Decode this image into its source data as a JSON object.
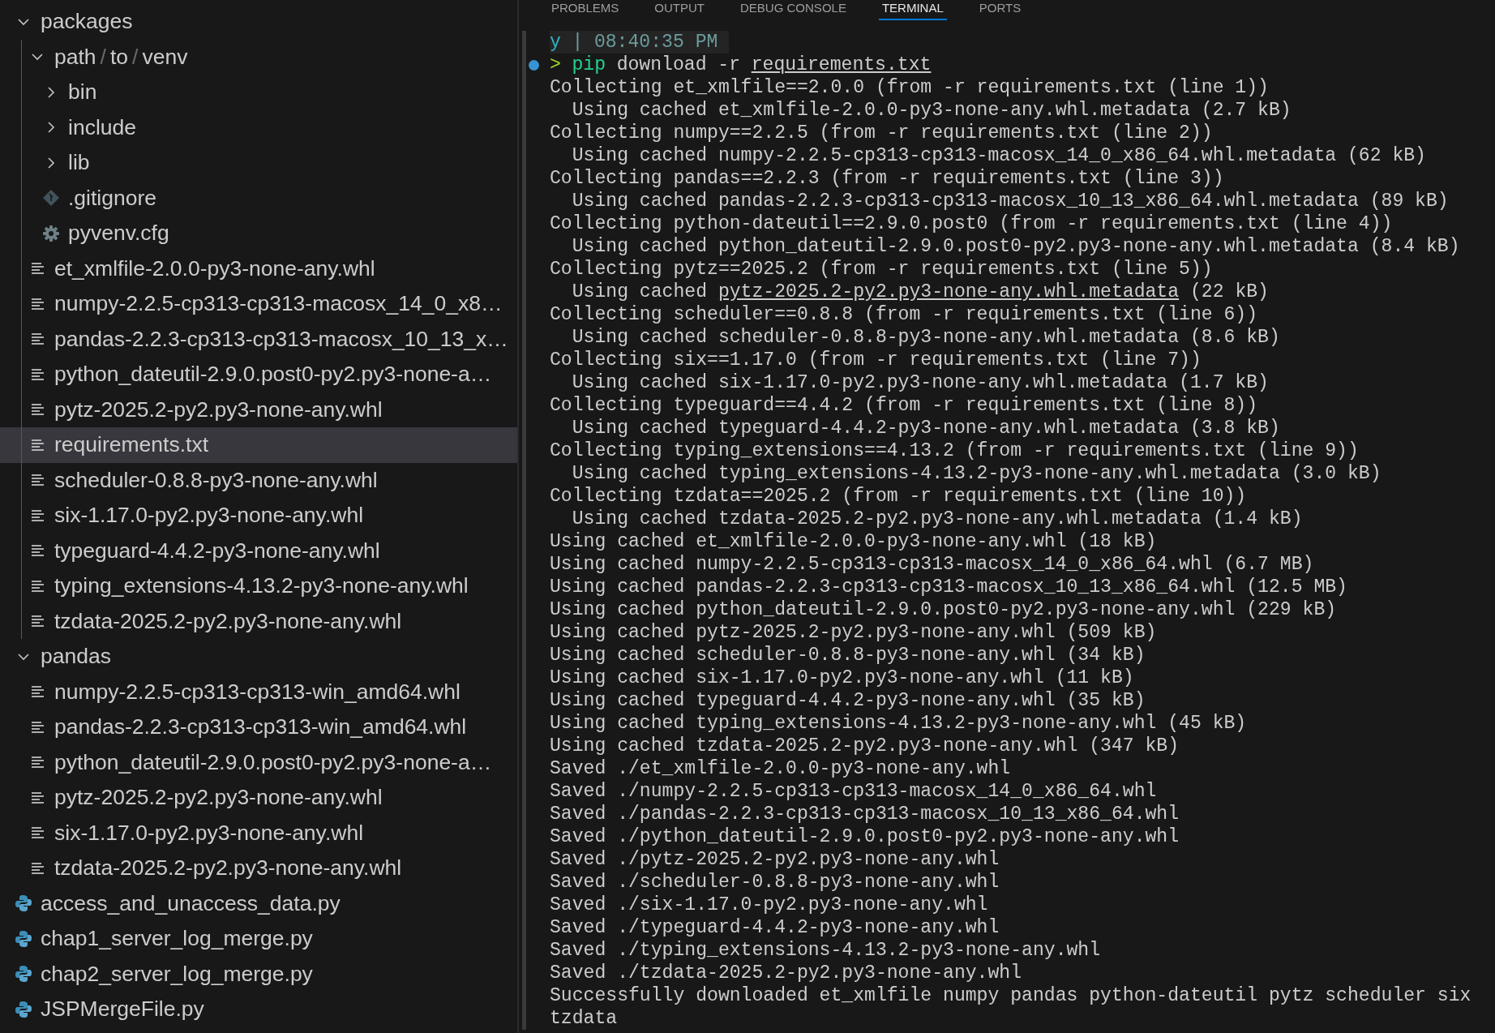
{
  "explorer": {
    "tree": [
      {
        "label": "packages",
        "kind": "folder",
        "expanded": true,
        "selected": false,
        "children": [
          {
            "label_parts": [
              {
                "text": "path",
                "kind": "name"
              },
              {
                "text": "/",
                "kind": "separator"
              },
              {
                "text": "to",
                "kind": "name"
              },
              {
                "text": "/",
                "kind": "separator"
              },
              {
                "text": "venv",
                "kind": "name"
              }
            ],
            "kind": "folder",
            "expanded": true,
            "selected": false,
            "children": [
              {
                "label": "bin",
                "kind": "folder",
                "expanded": false,
                "selected": false
              },
              {
                "label": "include",
                "kind": "folder",
                "expanded": false,
                "selected": false
              },
              {
                "label": "lib",
                "kind": "folder",
                "expanded": false,
                "selected": false
              },
              {
                "label": ".gitignore",
                "kind": "git-file",
                "selected": false
              },
              {
                "label": "pyvenv.cfg",
                "kind": "config-file",
                "selected": false
              }
            ]
          },
          {
            "label": "et_xmlfile-2.0.0-py3-none-any.whl",
            "kind": "text-file",
            "selected": false
          },
          {
            "label": "numpy-2.2.5-cp313-cp313-macosx_14_0_x8…",
            "kind": "text-file",
            "selected": false
          },
          {
            "label": "pandas-2.2.3-cp313-cp313-macosx_10_13_x…",
            "kind": "text-file",
            "selected": false
          },
          {
            "label": "python_dateutil-2.9.0.post0-py2.py3-none-a…",
            "kind": "text-file",
            "selected": false
          },
          {
            "label": "pytz-2025.2-py2.py3-none-any.whl",
            "kind": "text-file",
            "selected": false
          },
          {
            "label": "requirements.txt",
            "kind": "text-file",
            "selected": true
          },
          {
            "label": "scheduler-0.8.8-py3-none-any.whl",
            "kind": "text-file",
            "selected": false
          },
          {
            "label": "six-1.17.0-py2.py3-none-any.whl",
            "kind": "text-file",
            "selected": false
          },
          {
            "label": "typeguard-4.4.2-py3-none-any.whl",
            "kind": "text-file",
            "selected": false
          },
          {
            "label": "typing_extensions-4.13.2-py3-none-any.whl",
            "kind": "text-file",
            "selected": false
          },
          {
            "label": "tzdata-2025.2-py2.py3-none-any.whl",
            "kind": "text-file",
            "selected": false
          }
        ]
      },
      {
        "label": "pandas",
        "kind": "folder",
        "expanded": true,
        "selected": false,
        "children": [
          {
            "label": "numpy-2.2.5-cp313-cp313-win_amd64.whl",
            "kind": "text-file",
            "selected": false
          },
          {
            "label": "pandas-2.2.3-cp313-cp313-win_amd64.whl",
            "kind": "text-file",
            "selected": false
          },
          {
            "label": "python_dateutil-2.9.0.post0-py2.py3-none-a…",
            "kind": "text-file",
            "selected": false
          },
          {
            "label": "pytz-2025.2-py2.py3-none-any.whl",
            "kind": "text-file",
            "selected": false
          },
          {
            "label": "six-1.17.0-py2.py3-none-any.whl",
            "kind": "text-file",
            "selected": false
          },
          {
            "label": "tzdata-2025.2-py2.py3-none-any.whl",
            "kind": "text-file",
            "selected": false
          }
        ]
      },
      {
        "label": "access_and_unaccess_data.py",
        "kind": "python-file",
        "selected": false
      },
      {
        "label": "chap1_server_log_merge.py",
        "kind": "python-file",
        "selected": false
      },
      {
        "label": "chap2_server_log_merge.py",
        "kind": "python-file",
        "selected": false
      },
      {
        "label": "JSPMergeFile.py",
        "kind": "python-file",
        "selected": false
      }
    ]
  },
  "panel": {
    "tabs": [
      {
        "label": "PROBLEMS",
        "selected": false
      },
      {
        "label": "OUTPUT",
        "selected": false
      },
      {
        "label": "DEBUG CONSOLE",
        "selected": false
      },
      {
        "label": "TERMINAL",
        "selected": true
      },
      {
        "label": "PORTS",
        "selected": false
      }
    ],
    "terminal": {
      "lines": [
        {
          "kind": "header",
          "user": "y",
          "separator": "|",
          "time": "08:40:35 PM"
        },
        {
          "kind": "command",
          "prompt": ">",
          "program": "pip",
          "args": "download -r",
          "file": "requirements.txt"
        },
        {
          "kind": "output",
          "text": "Collecting et_xmlfile==2.0.0 (from -r requirements.txt (line 1))"
        },
        {
          "kind": "output",
          "text": "  Using cached et_xmlfile-2.0.0-py3-none-any.whl.metadata (2.7 kB)"
        },
        {
          "kind": "output",
          "text": "Collecting numpy==2.2.5 (from -r requirements.txt (line 2))"
        },
        {
          "kind": "output",
          "text": "  Using cached numpy-2.2.5-cp313-cp313-macosx_14_0_x86_64.whl.metadata (62 kB)"
        },
        {
          "kind": "output",
          "text": "Collecting pandas==2.2.3 (from -r requirements.txt (line 3))"
        },
        {
          "kind": "output",
          "text": "  Using cached pandas-2.2.3-cp313-cp313-macosx_10_13_x86_64.whl.metadata (89 kB)"
        },
        {
          "kind": "output",
          "text": "Collecting python-dateutil==2.9.0.post0 (from -r requirements.txt (line 4))"
        },
        {
          "kind": "output",
          "text": "  Using cached python_dateutil-2.9.0.post0-py2.py3-none-any.whl.metadata (8.4 kB)"
        },
        {
          "kind": "output",
          "text": "Collecting pytz==2025.2 (from -r requirements.txt (line 5))"
        },
        {
          "kind": "link-output",
          "before": "  Using cached ",
          "link": "pytz-2025.2-py2.py3-none-any.whl.metadata",
          "after": " (22 kB)"
        },
        {
          "kind": "output",
          "text": "Collecting scheduler==0.8.8 (from -r requirements.txt (line 6))"
        },
        {
          "kind": "output",
          "text": "  Using cached scheduler-0.8.8-py3-none-any.whl.metadata (8.6 kB)"
        },
        {
          "kind": "output",
          "text": "Collecting six==1.17.0 (from -r requirements.txt (line 7))"
        },
        {
          "kind": "output",
          "text": "  Using cached six-1.17.0-py2.py3-none-any.whl.metadata (1.7 kB)"
        },
        {
          "kind": "output",
          "text": "Collecting typeguard==4.4.2 (from -r requirements.txt (line 8))"
        },
        {
          "kind": "output",
          "text": "  Using cached typeguard-4.4.2-py3-none-any.whl.metadata (3.8 kB)"
        },
        {
          "kind": "output",
          "text": "Collecting typing_extensions==4.13.2 (from -r requirements.txt (line 9))"
        },
        {
          "kind": "output",
          "text": "  Using cached typing_extensions-4.13.2-py3-none-any.whl.metadata (3.0 kB)"
        },
        {
          "kind": "output",
          "text": "Collecting tzdata==2025.2 (from -r requirements.txt (line 10))"
        },
        {
          "kind": "output",
          "text": "  Using cached tzdata-2025.2-py2.py3-none-any.whl.metadata (1.4 kB)"
        },
        {
          "kind": "output",
          "text": "Using cached et_xmlfile-2.0.0-py3-none-any.whl (18 kB)"
        },
        {
          "kind": "output",
          "text": "Using cached numpy-2.2.5-cp313-cp313-macosx_14_0_x86_64.whl (6.7 MB)"
        },
        {
          "kind": "output",
          "text": "Using cached pandas-2.2.3-cp313-cp313-macosx_10_13_x86_64.whl (12.5 MB)"
        },
        {
          "kind": "output",
          "text": "Using cached python_dateutil-2.9.0.post0-py2.py3-none-any.whl (229 kB)"
        },
        {
          "kind": "output",
          "text": "Using cached pytz-2025.2-py2.py3-none-any.whl (509 kB)"
        },
        {
          "kind": "output",
          "text": "Using cached scheduler-0.8.8-py3-none-any.whl (34 kB)"
        },
        {
          "kind": "output",
          "text": "Using cached six-1.17.0-py2.py3-none-any.whl (11 kB)"
        },
        {
          "kind": "output",
          "text": "Using cached typeguard-4.4.2-py3-none-any.whl (35 kB)"
        },
        {
          "kind": "output",
          "text": "Using cached typing_extensions-4.13.2-py3-none-any.whl (45 kB)"
        },
        {
          "kind": "output",
          "text": "Using cached tzdata-2025.2-py2.py3-none-any.whl (347 kB)"
        },
        {
          "kind": "output",
          "text": "Saved ./et_xmlfile-2.0.0-py3-none-any.whl"
        },
        {
          "kind": "output",
          "text": "Saved ./numpy-2.2.5-cp313-cp313-macosx_14_0_x86_64.whl"
        },
        {
          "kind": "output",
          "text": "Saved ./pandas-2.2.3-cp313-cp313-macosx_10_13_x86_64.whl"
        },
        {
          "kind": "output",
          "text": "Saved ./python_dateutil-2.9.0.post0-py2.py3-none-any.whl"
        },
        {
          "kind": "output",
          "text": "Saved ./pytz-2025.2-py2.py3-none-any.whl"
        },
        {
          "kind": "output",
          "text": "Saved ./scheduler-0.8.8-py3-none-any.whl"
        },
        {
          "kind": "output",
          "text": "Saved ./six-1.17.0-py2.py3-none-any.whl"
        },
        {
          "kind": "output",
          "text": "Saved ./typeguard-4.4.2-py3-none-any.whl"
        },
        {
          "kind": "output",
          "text": "Saved ./typing_extensions-4.13.2-py3-none-any.whl"
        },
        {
          "kind": "output",
          "text": "Saved ./tzdata-2025.2-py2.py3-none-any.whl"
        },
        {
          "kind": "output",
          "text": "Successfully downloaded et_xmlfile numpy pandas python-dateutil pytz scheduler six"
        },
        {
          "kind": "output",
          "text": "tzdata"
        }
      ]
    }
  }
}
